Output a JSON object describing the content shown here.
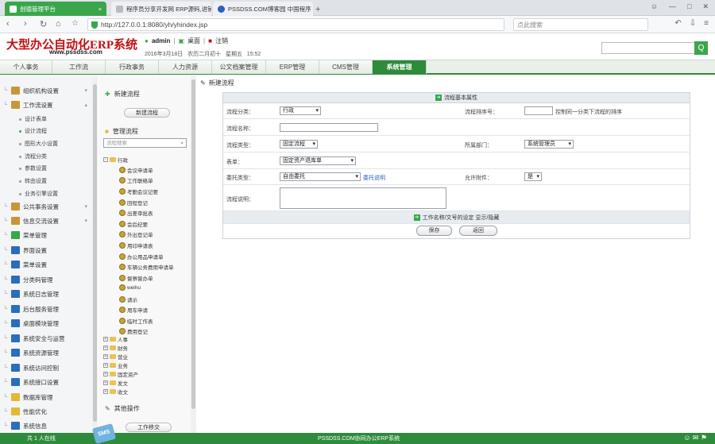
{
  "browser": {
    "tabs": [
      {
        "label": "创德管理平台"
      },
      {
        "label": "程序员分享开发网 ERP源码,进销"
      },
      {
        "label": "PSSDSS.COM博客园 中国程序"
      }
    ],
    "new_tab": "+",
    "url": "http://127.0.0.1:8080/yh/yhindex.jsp",
    "search_placeholder": "点此搜索"
  },
  "header": {
    "logo": "大型办公自动化ERP系统",
    "logo_url": "www.pssdss.com",
    "user": "admin",
    "desktop": "桌面",
    "logout": "注销",
    "date": "2016年3月18日",
    "lunar": "农历二月初十",
    "weekday": "星期五",
    "time": "15:52",
    "search_button": "Q"
  },
  "menu": [
    {
      "label": "个人事务"
    },
    {
      "label": "工作流"
    },
    {
      "label": "行政事务"
    },
    {
      "label": "人力资源"
    },
    {
      "label": "公文档案管理"
    },
    {
      "label": "ERP管理"
    },
    {
      "label": "CMS管理"
    },
    {
      "label": "系统管理"
    }
  ],
  "sidebar": {
    "items": [
      {
        "label": "组织机构设置",
        "color": "#c8963a"
      },
      {
        "label": "工作流设置",
        "color": "#c8963a"
      },
      {
        "label": "公共事务设置",
        "color": "#c8963a"
      },
      {
        "label": "信息交流设置",
        "color": "#c8963a"
      },
      {
        "label": "菜单管理",
        "color": "#3aa64b"
      },
      {
        "label": "界面设置",
        "color": "#2a6dbf"
      },
      {
        "label": "菜单设置",
        "color": "#2a6dbf"
      },
      {
        "label": "分类码管理",
        "color": "#2a6dbf"
      },
      {
        "label": "系统日志管理",
        "color": "#2a6dbf"
      },
      {
        "label": "后台服务管理",
        "color": "#2a6dbf"
      },
      {
        "label": "桌面模块管理",
        "color": "#2a6dbf"
      },
      {
        "label": "系统安全与运营",
        "color": "#2a6dbf"
      },
      {
        "label": "系统资源管理",
        "color": "#2a6dbf"
      },
      {
        "label": "系统访问控制",
        "color": "#2a6dbf"
      },
      {
        "label": "系统接口设置",
        "color": "#2a6dbf"
      },
      {
        "label": "数据库管理",
        "color": "#e0b93a"
      },
      {
        "label": "性能优化",
        "color": "#e0b93a"
      },
      {
        "label": "系统信息",
        "color": "#2a6dbf"
      }
    ],
    "subitems": [
      {
        "label": "设计表单"
      },
      {
        "label": "设计流程"
      },
      {
        "label": "图形大小设置"
      },
      {
        "label": "流程分类"
      },
      {
        "label": "参数设置"
      },
      {
        "label": "转由设置"
      },
      {
        "label": "业务引擎设置"
      }
    ]
  },
  "middle": {
    "new_flow": "新建流程",
    "new_flow_button": "新建流程",
    "manage_flow": "管理流程",
    "search_placeholder": "流程搜索",
    "tree_root": "行政",
    "tree_items": [
      "会议申请单",
      "工作联络单",
      "考勤会议记要",
      "回程登记",
      "出差审批表",
      "会后纪要",
      "外出登记单",
      "用印申请表",
      "办公用品申请单",
      "车辆公务费用申请单",
      "督察督办单",
      "weihu",
      "请示",
      "用车申请",
      "临时工作表",
      "费用登记"
    ],
    "tree_folders": [
      "人事",
      "财务",
      "营业",
      "业务",
      "固定资产",
      "发文",
      "收文"
    ],
    "other_ops": "其他操作",
    "work_transfer": "工作移交"
  },
  "content": {
    "title": "新建流程",
    "section_header": "流程基本属性",
    "category_label": "流程分类：",
    "category_value": "行政",
    "sort_label": "流程排序号：",
    "sort_note": "控制同一分类下流程的排序",
    "name_label": "流程名称：",
    "type_label": "流程类型：",
    "type_value": "固定流程",
    "dept_label": "所属部门：",
    "dept_value": "系统管理员",
    "form_label": "表单：",
    "form_value": "固定资产退库单",
    "delegate_label": "委托类型：",
    "delegate_value": "自由委托",
    "delegate_note": "委托说明",
    "attach_label": "允许附件：",
    "attach_value": "是",
    "desc_label": "流程说明：",
    "doc_link": "工作名称/文号的设定 显示/隐藏",
    "save_button": "保存",
    "back_button": "返回"
  },
  "footer": {
    "online": "共 1 人在线",
    "center": "PSSDSS.COM协同办公ERP系统",
    "sms": "SMS"
  }
}
